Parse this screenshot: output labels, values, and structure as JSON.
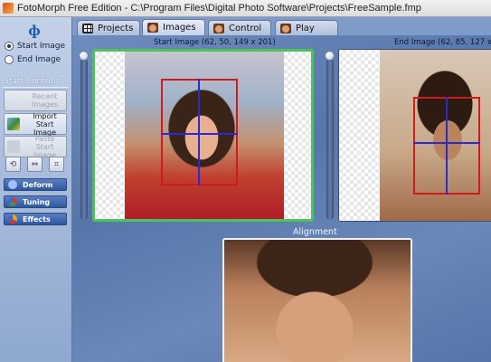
{
  "window": {
    "title": "FotoMorph Free Edition - C:\\Program Files\\Digital Photo Software\\Projects\\FreeSample.fmp"
  },
  "left_panel": {
    "logo": "ф",
    "image_select": [
      {
        "label": "Start Image",
        "checked": true
      },
      {
        "label": "End Image",
        "checked": false
      }
    ],
    "section_label": "Start Controls",
    "buttons": [
      {
        "label": "Recent Images",
        "line1": "Recent",
        "line2": "Images",
        "enabled": false
      },
      {
        "label": "Import Start Image",
        "line1": "Import",
        "line2": "Start Image",
        "enabled": true
      },
      {
        "label": "Paste Start Image",
        "line1": "Paste",
        "line2": "Start Image",
        "enabled": false
      }
    ],
    "small_buttons": [
      "rotate",
      "flip",
      "crop"
    ],
    "tools": [
      {
        "label": "Deform",
        "color": "#3a6ad0"
      },
      {
        "label": "Tuning",
        "color": "#d23a3a"
      },
      {
        "label": "Effects",
        "color": "#e6a41e"
      }
    ]
  },
  "tabs": [
    {
      "label": "Projects",
      "icon": "grid-icon",
      "active": false
    },
    {
      "label": "Images",
      "icon": "face-icon",
      "active": true
    },
    {
      "label": "Control",
      "icon": "face-icon",
      "active": false
    },
    {
      "label": "Play",
      "icon": "face-icon",
      "active": false
    }
  ],
  "start_image": {
    "label": "Start Image (62, 50, 149 x 201)"
  },
  "end_image": {
    "label": "End Image (62, 85, 127 x"
  },
  "alignment": {
    "label": "Alignment"
  },
  "colors": {
    "start_frame_border": "#4ec25a",
    "face_rect": "#d21a1a",
    "feature_lines": "#2a2ad8"
  }
}
